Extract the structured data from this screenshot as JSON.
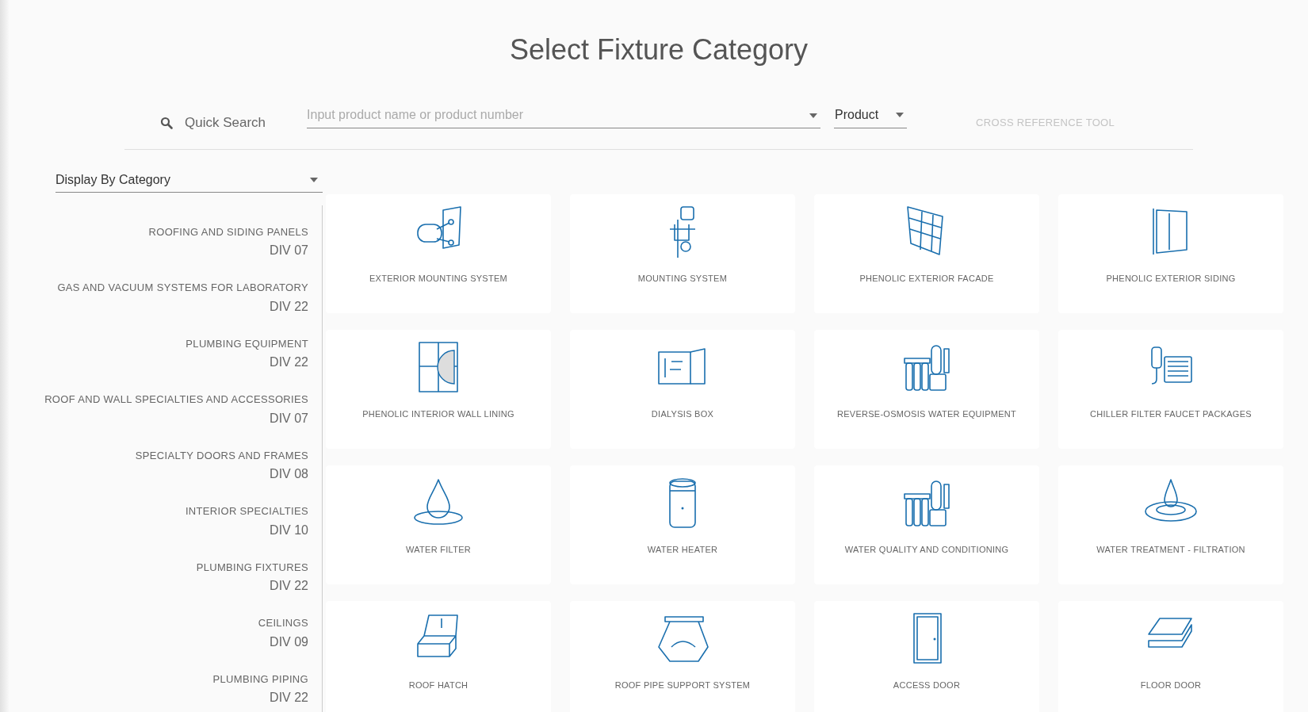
{
  "title": "Select Fixture Category",
  "search": {
    "label": "Quick Search",
    "placeholder": "Input product name or product number",
    "type_value": "Product",
    "cross_reference": "CROSS REFERENCE TOOL"
  },
  "display_select": {
    "value": "Display By Category"
  },
  "categories": [
    {
      "name": "ROOFING AND SIDING PANELS",
      "division": "DIV 07"
    },
    {
      "name": "GAS AND VACUUM SYSTEMS FOR LABORATORY",
      "division": "DIV 22"
    },
    {
      "name": "PLUMBING EQUIPMENT",
      "division": "DIV 22"
    },
    {
      "name": "ROOF AND WALL SPECIALTIES AND ACCESSORIES",
      "division": "DIV 07"
    },
    {
      "name": "SPECIALTY DOORS AND FRAMES",
      "division": "DIV 08"
    },
    {
      "name": "INTERIOR SPECIALTIES",
      "division": "DIV 10"
    },
    {
      "name": "PLUMBING FIXTURES",
      "division": "DIV 22"
    },
    {
      "name": "CEILINGS",
      "division": "DIV 09"
    },
    {
      "name": "PLUMBING PIPING",
      "division": "DIV 22"
    }
  ],
  "products": [
    {
      "label": "EXTERIOR MOUNTING SYSTEM"
    },
    {
      "label": "MOUNTING SYSTEM"
    },
    {
      "label": "PHENOLIC EXTERIOR FACADE"
    },
    {
      "label": "PHENOLIC EXTERIOR SIDING"
    },
    {
      "label": "PHENOLIC INTERIOR WALL LINING"
    },
    {
      "label": "DIALYSIS BOX"
    },
    {
      "label": "REVERSE-OSMOSIS WATER EQUIPMENT"
    },
    {
      "label": "CHILLER FILTER FAUCET PACKAGES"
    },
    {
      "label": "WATER FILTER"
    },
    {
      "label": "WATER HEATER"
    },
    {
      "label": "WATER QUALITY AND CONDITIONING"
    },
    {
      "label": "WATER TREATMENT - FILTRATION"
    },
    {
      "label": "ROOF HATCH"
    },
    {
      "label": "ROOF PIPE SUPPORT SYSTEM"
    },
    {
      "label": "ACCESS DOOR"
    },
    {
      "label": "FLOOR DOOR"
    }
  ]
}
